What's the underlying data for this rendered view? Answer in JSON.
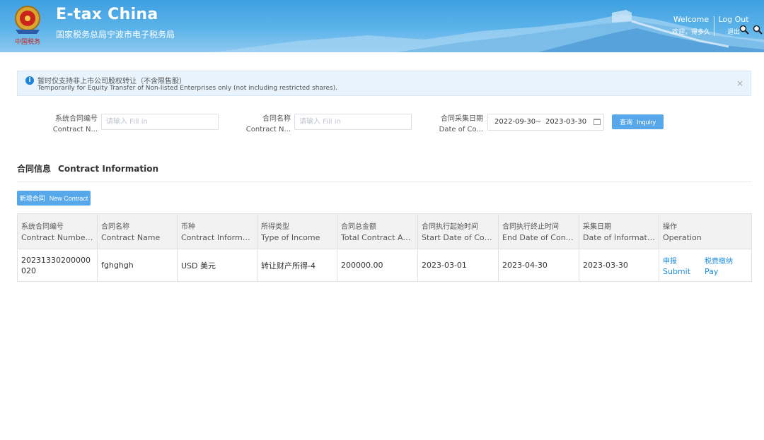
{
  "header": {
    "title": "E-tax China",
    "subtitle": "国家税务总局宁波市电子税务局",
    "welcome_en": "Welcome",
    "welcome_zh": "欢迎，得多久",
    "logout_en": "Log Out",
    "logout_zh": "退出",
    "emblem_text": "中国税务"
  },
  "alert": {
    "zh": "暂时仅支持非上市公司股权转让（不含限售股）",
    "en": "Temporarily for Equity Transfer of Non-listed Enterprises only (not including restricted shares).",
    "close": "×"
  },
  "filters": {
    "contract_number": {
      "label_zh": "系统合同编号",
      "label_en": "Contract N...",
      "placeholder": "请输入 Fill in"
    },
    "contract_name": {
      "label_zh": "合同名称",
      "label_en": "Contract N...",
      "placeholder": "请输入 Fill in"
    },
    "date": {
      "label_zh": "合同采集日期",
      "label_en": "Date of Co...",
      "start": "2022-09-30",
      "sep": "~",
      "end": "2023-03-30"
    },
    "inquiry_zh": "查询",
    "inquiry_en": "Inquiry"
  },
  "section": {
    "title_zh": "合同信息",
    "title_en": "Contract Information"
  },
  "new_contract": {
    "zh": "新增合同",
    "en": "New Contract"
  },
  "table": {
    "columns": [
      {
        "zh": "系统合同编号",
        "en": "Contract Number i..."
      },
      {
        "zh": "合同名称",
        "en": "Contract Name"
      },
      {
        "zh": "币种",
        "en": "Contract Informati..."
      },
      {
        "zh": "所得类型",
        "en": "Type of Income"
      },
      {
        "zh": "合同总金额",
        "en": "Total Contract Am..."
      },
      {
        "zh": "合同执行起始时间",
        "en": "Start Date of Contr..."
      },
      {
        "zh": "合同执行终止时间",
        "en": "End Date of Contr..."
      },
      {
        "zh": "采集日期",
        "en": "Date of Informatio..."
      },
      {
        "zh": "操作",
        "en": "Operation"
      }
    ],
    "rows": [
      {
        "contract_number": "20231330200000020",
        "contract_name": "fghghgh",
        "currency": "USD 美元",
        "income_type": "转让财产所得-4",
        "total_amount": "200000.00",
        "start_date": "2023-03-01",
        "end_date": "2023-04-30",
        "collect_date": "2023-03-30",
        "ops": {
          "submit_zh": "申报",
          "submit_en": "Submit",
          "pay_zh": "税费缴纳",
          "pay_en": "Pay"
        }
      }
    ]
  },
  "colors": {
    "accent": "#1f8ee0",
    "button": "#56a8eb",
    "header": "#3f9fe0"
  }
}
